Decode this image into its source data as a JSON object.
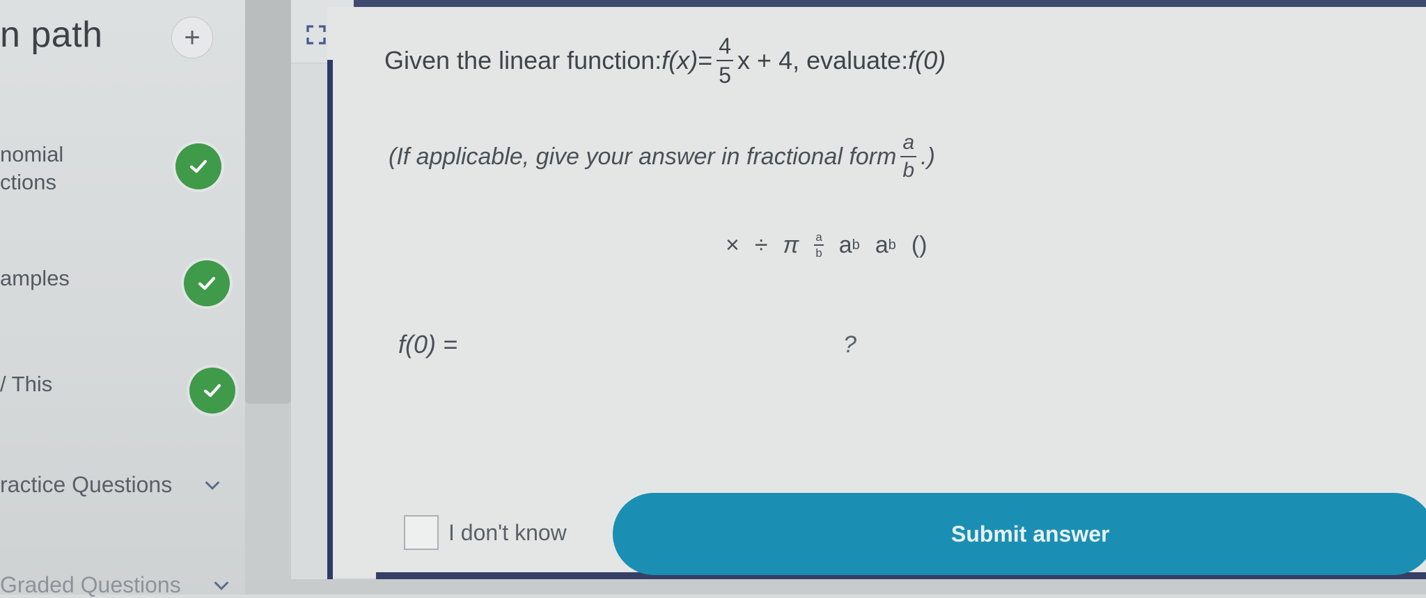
{
  "sidebar": {
    "path_title": "n path",
    "add_button": "+",
    "lessons": [
      {
        "line1": "nomial",
        "line2": "ctions",
        "status": "complete"
      },
      {
        "line1": "amples",
        "line2": "",
        "status": "complete"
      },
      {
        "line1": "/ This",
        "line2": "",
        "status": "complete"
      }
    ],
    "sections": [
      {
        "label": "ractice Questions"
      },
      {
        "label": "Graded Questions"
      }
    ]
  },
  "question": {
    "prefix": "Given the linear function: ",
    "fx": "f(x)",
    "equals": " = ",
    "numerator": "4",
    "denominator": "5",
    "after_frac": "x + 4, evaluate: ",
    "evaluate": "f(0)"
  },
  "hint": {
    "text": "(If applicable, give your answer in fractional form ",
    "numerator": "a",
    "denominator": "b",
    "close": ".)"
  },
  "toolbar": {
    "times": "×",
    "divide": "÷",
    "pi": "π",
    "frac_num": "a",
    "frac_den": "b",
    "power_base": "a",
    "power_exp": "b",
    "sub_base": "a",
    "sub_index": "b",
    "parens": "()"
  },
  "answer": {
    "label": "f(0) =",
    "value": "",
    "placeholder": "?"
  },
  "footer": {
    "idk_label": "I don't know",
    "submit_label": "Submit answer"
  },
  "colors": {
    "check_green": "#3f9a4a",
    "submit_blue": "#1a8fb3",
    "border_navy": "#2f3a66"
  }
}
